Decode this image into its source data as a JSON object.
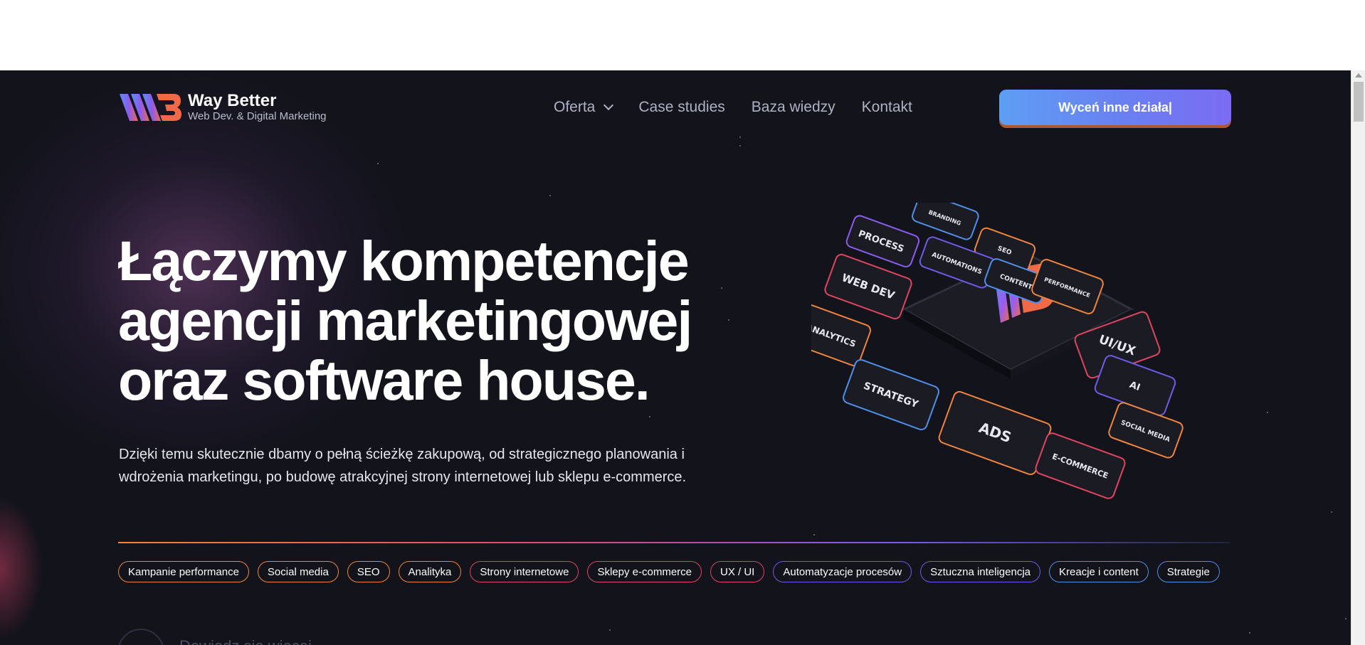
{
  "brand": {
    "name": "Way Better",
    "tagline": "Web Dev. & Digital Marketing"
  },
  "nav": {
    "items": [
      "Oferta",
      "Case studies",
      "Baza wiedzy",
      "Kontakt"
    ]
  },
  "cta": {
    "label": "Wyceń inne działa|"
  },
  "hero": {
    "headline": [
      "Łączymy kompetencje",
      "agencji marketingowej",
      "oraz software house."
    ],
    "description": [
      "Dzięki temu skutecznie dbamy o pełną ścieżkę zakupową, od strategicznego planowania i",
      "wdrożenia marketingu, po budowę atrakcyjnej strony internetowej lub sklepu e-commerce."
    ],
    "next_label": "Dowiedz się więcej"
  },
  "tags": [
    {
      "label": "Kampanie performance",
      "color": "#f0843e"
    },
    {
      "label": "Social media",
      "color": "#f0843e"
    },
    {
      "label": "SEO",
      "color": "#f0843e"
    },
    {
      "label": "Analityka",
      "color": "#f0843e"
    },
    {
      "label": "Strony internetowe",
      "color": "#e0455f"
    },
    {
      "label": "Sklepy e-commerce",
      "color": "#e0455f"
    },
    {
      "label": "UX / UI",
      "color": "#e0455f"
    },
    {
      "label": "Automatyzacje procesów",
      "color": "#6c5ce7"
    },
    {
      "label": "Sztuczna inteligencja",
      "color": "#6c5ce7"
    },
    {
      "label": "Kreacje i content",
      "color": "#4f8fe8"
    },
    {
      "label": "Strategie",
      "color": "#4f8fe8"
    }
  ],
  "illustration": {
    "tiles": [
      "PROCESS",
      "BRANDING",
      "SEO",
      "AUTOMATIONS",
      "CONTENT",
      "PERFORMANCE",
      "WEB DEV",
      "ANALYTICS",
      "UI/UX",
      "STRATEGY",
      "AI",
      "ADS",
      "SOCIAL MEDIA",
      "E-COMMERCE"
    ]
  },
  "colors": {
    "background": "#12131b",
    "accent_blue": "#5e9ef4",
    "accent_purple": "#7b6cf3",
    "accent_orange": "#f0843e",
    "accent_red": "#e0455f"
  }
}
